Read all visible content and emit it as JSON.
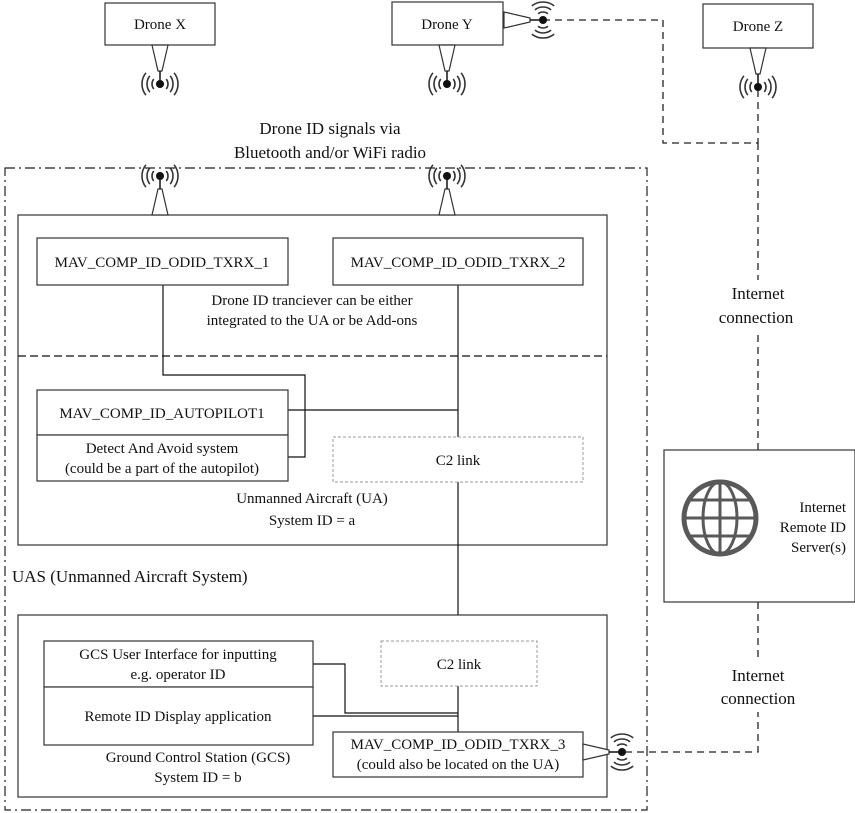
{
  "drones": [
    {
      "label": "Drone X"
    },
    {
      "label": "Drone Y"
    },
    {
      "label": "Drone Z"
    }
  ],
  "signals_caption": [
    "Drone ID signals via",
    "Bluetooth and/or WiFi radio"
  ],
  "uas_label": "UAS (Unmanned Aircraft System)",
  "ua": {
    "txrx1": "MAV_COMP_ID_ODID_TXRX_1",
    "txrx2": "MAV_COMP_ID_ODID_TXRX_2",
    "transceiver_note": [
      "Drone ID tranciever can be either",
      "integrated to the UA or be Add-ons"
    ],
    "autopilot": "MAV_COMP_ID_AUTOPILOT1",
    "daa": [
      "Detect And Avoid system",
      "(could be a part of the autopilot)"
    ],
    "c2": "C2 link",
    "caption": [
      "Unmanned Aircraft (UA)",
      "System ID = a"
    ]
  },
  "gcs": {
    "ui": [
      "GCS User Interface for inputting",
      "e.g. operator ID"
    ],
    "display": "Remote ID Display application",
    "c2": "C2 link",
    "txrx3": [
      "MAV_COMP_ID_ODID_TXRX_3",
      "(could also be located on the UA)"
    ],
    "caption": [
      "Ground Control Station (GCS)",
      "System ID = b"
    ]
  },
  "internet_top": [
    "Internet",
    "connection"
  ],
  "internet_bottom": [
    "Internet",
    "connection"
  ],
  "server": {
    "label": [
      "Internet",
      "Remote ID",
      "Server(s)"
    ],
    "icon": "globe-icon",
    "icon_color": "#595959"
  }
}
